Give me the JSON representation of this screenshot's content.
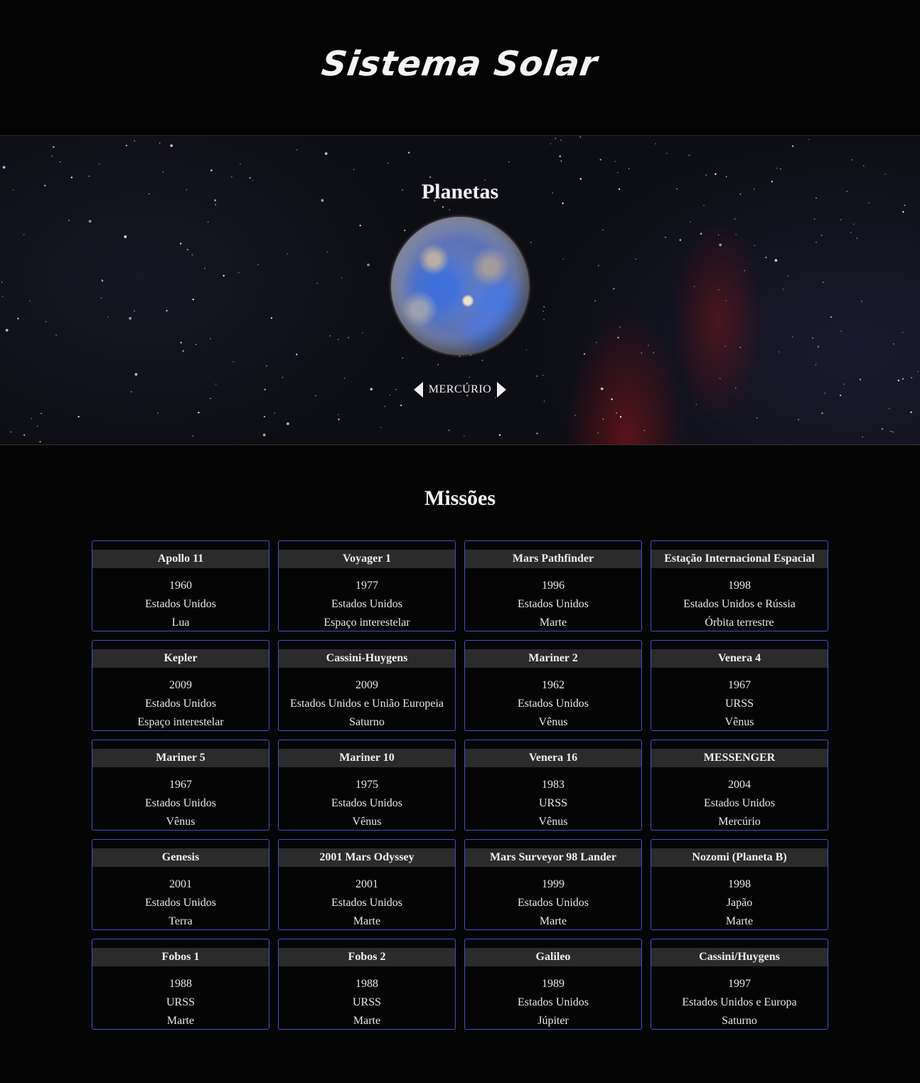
{
  "header": {
    "title": "Sistema Solar"
  },
  "planets": {
    "title": "Planetas",
    "current_planet": "MERCÚRIO",
    "icons": {
      "prev": "arrow-left-icon",
      "next": "arrow-right-icon"
    }
  },
  "missions": {
    "title": "Missões",
    "items": [
      {
        "name": "Apollo 11",
        "year": "1960",
        "country": "Estados Unidos",
        "target": "Lua"
      },
      {
        "name": "Voyager 1",
        "year": "1977",
        "country": "Estados Unidos",
        "target": "Espaço interestelar"
      },
      {
        "name": "Mars Pathfinder",
        "year": "1996",
        "country": "Estados Unidos",
        "target": "Marte"
      },
      {
        "name": "Estação Internacional Espacial",
        "year": "1998",
        "country": "Estados Unidos e Rússia",
        "target": "Órbita terrestre"
      },
      {
        "name": "Kepler",
        "year": "2009",
        "country": "Estados Unidos",
        "target": "Espaço interestelar"
      },
      {
        "name": "Cassini-Huygens",
        "year": "2009",
        "country": "Estados Unidos e União Europeia",
        "target": "Saturno"
      },
      {
        "name": "Mariner 2",
        "year": "1962",
        "country": "Estados Unidos",
        "target": "Vênus"
      },
      {
        "name": "Venera 4",
        "year": "1967",
        "country": "URSS",
        "target": "Vênus"
      },
      {
        "name": "Mariner 5",
        "year": "1967",
        "country": "Estados Unidos",
        "target": "Vênus"
      },
      {
        "name": "Mariner 10",
        "year": "1975",
        "country": "Estados Unidos",
        "target": "Vênus"
      },
      {
        "name": "Venera 16",
        "year": "1983",
        "country": "URSS",
        "target": "Vênus"
      },
      {
        "name": "MESSENGER",
        "year": "2004",
        "country": "Estados Unidos",
        "target": "Mercúrio"
      },
      {
        "name": "Genesis",
        "year": "2001",
        "country": "Estados Unidos",
        "target": "Terra"
      },
      {
        "name": "2001 Mars Odyssey",
        "year": "2001",
        "country": "Estados Unidos",
        "target": "Marte"
      },
      {
        "name": "Mars Surveyor 98 Lander",
        "year": "1999",
        "country": "Estados Unidos",
        "target": "Marte"
      },
      {
        "name": "Nozomi (Planeta B)",
        "year": "1998",
        "country": "Japão",
        "target": "Marte"
      },
      {
        "name": "Fobos 1",
        "year": "1988",
        "country": "URSS",
        "target": "Marte"
      },
      {
        "name": "Fobos 2",
        "year": "1988",
        "country": "URSS",
        "target": "Marte"
      },
      {
        "name": "Galileo",
        "year": "1989",
        "country": "Estados Unidos",
        "target": "Júpiter"
      },
      {
        "name": "Cassini/Huygens",
        "year": "1997",
        "country": "Estados Unidos e Europa",
        "target": "Saturno"
      }
    ]
  },
  "colors": {
    "background": "#050505",
    "card_border": "#4150c8",
    "card_header": "#2b2b2b",
    "text": "#e8e8e8"
  }
}
